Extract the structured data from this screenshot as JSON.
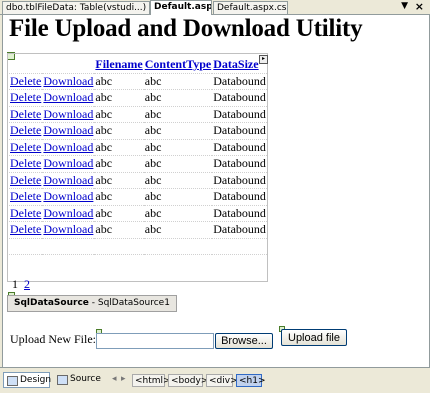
{
  "tabs": [
    {
      "label": "dbo.tblFileData: Table(vstudi...)",
      "active": false
    },
    {
      "label": "Default.aspx",
      "active": true
    },
    {
      "label": "Default.aspx.cs",
      "active": false
    }
  ],
  "tab_close": "×",
  "tab_dropdown": "▼",
  "page_title": "File Upload and Download Utility",
  "grid": {
    "headers": [
      "",
      "",
      "Filename",
      "ContentType",
      "DataSize"
    ],
    "rows": [
      [
        "Delete",
        "Download",
        "abc",
        "abc",
        "Databound"
      ],
      [
        "Delete",
        "Download",
        "abc",
        "abc",
        "Databound"
      ],
      [
        "Delete",
        "Download",
        "abc",
        "abc",
        "Databound"
      ],
      [
        "Delete",
        "Download",
        "abc",
        "abc",
        "Databound"
      ],
      [
        "Delete",
        "Download",
        "abc",
        "abc",
        "Databound"
      ],
      [
        "Delete",
        "Download",
        "abc",
        "abc",
        "Databound"
      ],
      [
        "Delete",
        "Download",
        "abc",
        "abc",
        "Databound"
      ],
      [
        "Delete",
        "Download",
        "abc",
        "abc",
        "Databound"
      ],
      [
        "Delete",
        "Download",
        "abc",
        "abc",
        "Databound"
      ],
      [
        "Delete",
        "Download",
        "abc",
        "abc",
        "Databound"
      ]
    ],
    "pager": [
      "1",
      "2"
    ]
  },
  "datasource": {
    "type_label": "SqlDataSource",
    "separator": " - ",
    "id": "SqlDataSource1"
  },
  "upload": {
    "label": "Upload New File:",
    "browse": "Browse...",
    "button": "Upload file"
  },
  "bottom": {
    "design": "Design",
    "source": "Source",
    "crumbs": [
      "<html>",
      "<body>",
      "<div>",
      "<h1>"
    ]
  }
}
